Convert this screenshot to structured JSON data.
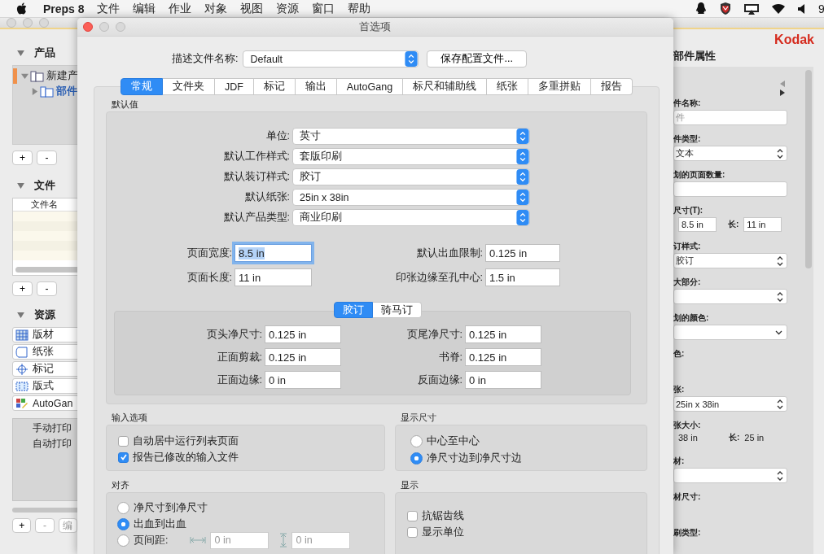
{
  "menubar": {
    "app": "Preps 8",
    "menus": [
      "文件",
      "编辑",
      "作业",
      "对象",
      "视图",
      "资源",
      "窗口",
      "帮助"
    ],
    "clock": "9"
  },
  "left_panel": {
    "products": {
      "title": "产品",
      "tree": [
        {
          "label": "新建产",
          "expanded": true,
          "selected": false,
          "children": [
            {
              "label": "部件",
              "expanded": false,
              "selected": true
            }
          ]
        }
      ],
      "buttons": [
        "+",
        "-"
      ]
    },
    "files": {
      "title": "文件",
      "column": "文件名",
      "buttons": [
        "+",
        "-"
      ]
    },
    "resources": {
      "title": "资源",
      "items": [
        {
          "kind": "plate",
          "label": "版材"
        },
        {
          "kind": "paper",
          "label": "纸张"
        },
        {
          "kind": "mark",
          "label": "标记"
        },
        {
          "kind": "layout",
          "label": "版式"
        },
        {
          "kind": "gang",
          "label": "AutoGan"
        }
      ],
      "jobs": [
        "手动打印",
        "自动打印"
      ],
      "buttons": [
        "+",
        "-",
        "编"
      ]
    }
  },
  "right_panel": {
    "logo": "Kodak",
    "title": "部件属性",
    "fields": [
      {
        "kind": "text",
        "label": "件名称:",
        "placeholder": "件"
      },
      {
        "kind": "select",
        "label": "件类型:",
        "value": "文本"
      },
      {
        "kind": "text",
        "label": "划的页面数量:"
      },
      {
        "kind": "pair",
        "label": "尺寸(T):",
        "first": "8.5 in",
        "second_label": "长:",
        "second": "11 in"
      },
      {
        "kind": "select",
        "label": "订样式:",
        "value": "胶订"
      },
      {
        "kind": "select",
        "label": "大部分:"
      },
      {
        "kind": "combo",
        "label": "划的颜色:"
      },
      {
        "kind": "label",
        "label": "色:"
      },
      {
        "kind": "select",
        "label": "张:",
        "value": "25in x 38in"
      },
      {
        "kind": "readout",
        "label": "张大小:",
        "first": "38 in",
        "second_label": "长:",
        "second": "25 in"
      },
      {
        "kind": "select",
        "label": "材:"
      },
      {
        "kind": "label",
        "label": "材尺寸:"
      },
      {
        "kind": "label",
        "label": "刷类型:"
      }
    ]
  },
  "dialog": {
    "title": "首选项",
    "profile": {
      "label": "描述文件名称:",
      "value": "Default",
      "button": "保存配置文件..."
    },
    "tabs": [
      {
        "label": "常规",
        "selected": true
      },
      {
        "label": "文件夹",
        "selected": false
      },
      {
        "label": "JDF",
        "selected": false
      },
      {
        "label": "标记",
        "selected": false
      },
      {
        "label": "输出",
        "selected": false
      },
      {
        "label": "AutoGang",
        "selected": false
      },
      {
        "label": "标尺和辅助线",
        "selected": false
      },
      {
        "label": "纸张",
        "selected": false
      },
      {
        "label": "多重拼贴",
        "selected": false
      },
      {
        "label": "报告",
        "selected": false
      }
    ],
    "defaults": {
      "title": "默认值",
      "selects": [
        {
          "label": "单位:",
          "value": "英寸"
        },
        {
          "label": "默认工作样式:",
          "value": "套版印刷"
        },
        {
          "label": "默认装订样式:",
          "value": "胶订"
        },
        {
          "label": "默认纸张:",
          "value": "25in x 38in"
        },
        {
          "label": "默认产品类型:",
          "value": "商业印刷"
        }
      ],
      "fields": [
        {
          "label": "页面宽度:",
          "value": "8.5 in",
          "focused": true
        },
        {
          "label": "默认出血限制:",
          "value": "0.125 in",
          "focused": false
        },
        {
          "label": "页面长度:",
          "value": "11 in",
          "focused": false
        },
        {
          "label": "印张边缘至孔中心:",
          "value": "1.5 in",
          "focused": false
        }
      ],
      "binding_tabs": [
        {
          "label": "胶订",
          "selected": true
        },
        {
          "label": "骑马订",
          "selected": false
        }
      ],
      "binding_fields": [
        {
          "label": "页头净尺寸:",
          "value": "0.125 in"
        },
        {
          "label": "页尾净尺寸:",
          "value": "0.125 in"
        },
        {
          "label": "正面剪裁:",
          "value": "0.125 in"
        },
        {
          "label": "书脊:",
          "value": "0.125 in"
        },
        {
          "label": "正面边缘:",
          "value": "0 in"
        },
        {
          "label": "反面边缘:",
          "value": "0 in"
        }
      ]
    },
    "input_options": {
      "title": "输入选项",
      "checks": [
        {
          "label": "自动居中运行列表页面",
          "checked": false
        },
        {
          "label": "报告已修改的输入文件",
          "checked": true
        }
      ]
    },
    "display_size": {
      "title": "显示尺寸",
      "radios": [
        {
          "label": "中心至中心",
          "selected": false
        },
        {
          "label": "净尺寸边到净尺寸边",
          "selected": true
        }
      ]
    },
    "align": {
      "title": "对齐",
      "radios": [
        {
          "label": "净尺寸到净尺寸",
          "selected": false
        },
        {
          "label": "出血到出血",
          "selected": true
        },
        {
          "label": "页间距:",
          "selected": false
        }
      ],
      "gaps": [
        {
          "value": "0 in",
          "disabled": true
        },
        {
          "value": "0 in",
          "disabled": true
        }
      ]
    },
    "display": {
      "title": "显示",
      "checks": [
        {
          "label": "抗锯齿线",
          "checked": false
        },
        {
          "label": "显示单位",
          "checked": false
        }
      ]
    }
  }
}
